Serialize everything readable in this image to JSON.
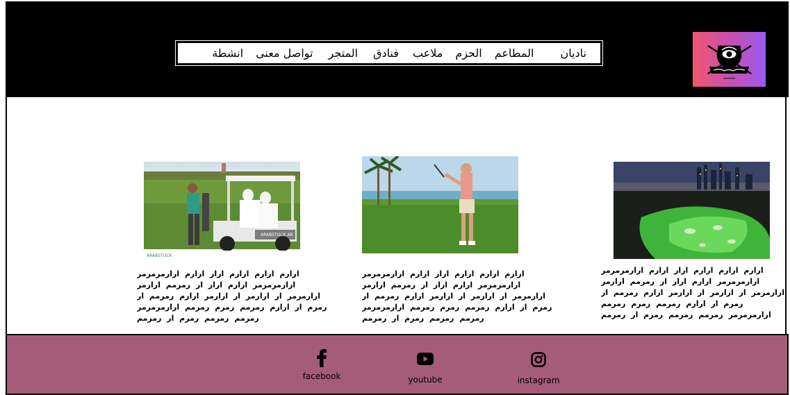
{
  "nav": {
    "items": [
      {
        "label": "ناديان"
      },
      {
        "label": "المطاعم"
      },
      {
        "label": "الحزم"
      },
      {
        "label": "ملاعب"
      },
      {
        "label": "فنادق"
      },
      {
        "label": "المتجر"
      },
      {
        "label": "تواصل معنى"
      },
      {
        "label": "انشطة"
      }
    ]
  },
  "cards": [
    {
      "image_icon": "golf-cart-photo",
      "watermark": "ARABSTOCK",
      "watermark_small": "ARABSTOCK AR",
      "text": "ارارم ارارم ارارم ارار ارارم ارارمرمرمر ارارمرمرمر ارارم ارار ار رمرمم ارارمر ارارمرمر ار ارارمر ار ارارمر ارارم رمرمم ار رمرم ار ارارم رمرمم رمرم رمرمم ارارمرمرمر رمرمم رمرمم رمرم ار رمرمم"
    },
    {
      "image_icon": "golfer-swing-photo",
      "text": "ارارم ارارم ارارم ارار ارارم ارارمرمرمر ارارمرمرمر ارارم ارار ار رمرمم ارارمر ارارمرمر ار ارارمر ار ارارمر ارارم رمرمم ار رمرم ار ارارم رمرمم رمرم رمرمم ارارمرمرمر رمرمم رمرمم رمرم ار رمرمم"
    },
    {
      "image_icon": "night-golf-course-photo",
      "text": "ارارم ارارم ارارم ارار ارارم ارارمرمرمر ارارمرمرمر ارارم ارار ار رمرمم ارارمر ارارمرمر ار ارارمر ار ارارمر ارارم رمرمم ار رمرم ار ارارم رمرمم رمرم رمرمم ارارمرمرمر رمرمم رمرمم رمرم ار رمرمم"
    }
  ],
  "footer": {
    "social": [
      {
        "label": "facebook",
        "icon": "facebook-icon"
      },
      {
        "label": "youtube",
        "icon": "youtube-icon"
      },
      {
        "label": "instagram",
        "icon": "instagram-icon"
      }
    ]
  },
  "colors": {
    "header_bg": "#000000",
    "footer_bg": "#a55c78",
    "logo_gradient_start": "#f0566d",
    "logo_gradient_end": "#9a5cf0"
  }
}
